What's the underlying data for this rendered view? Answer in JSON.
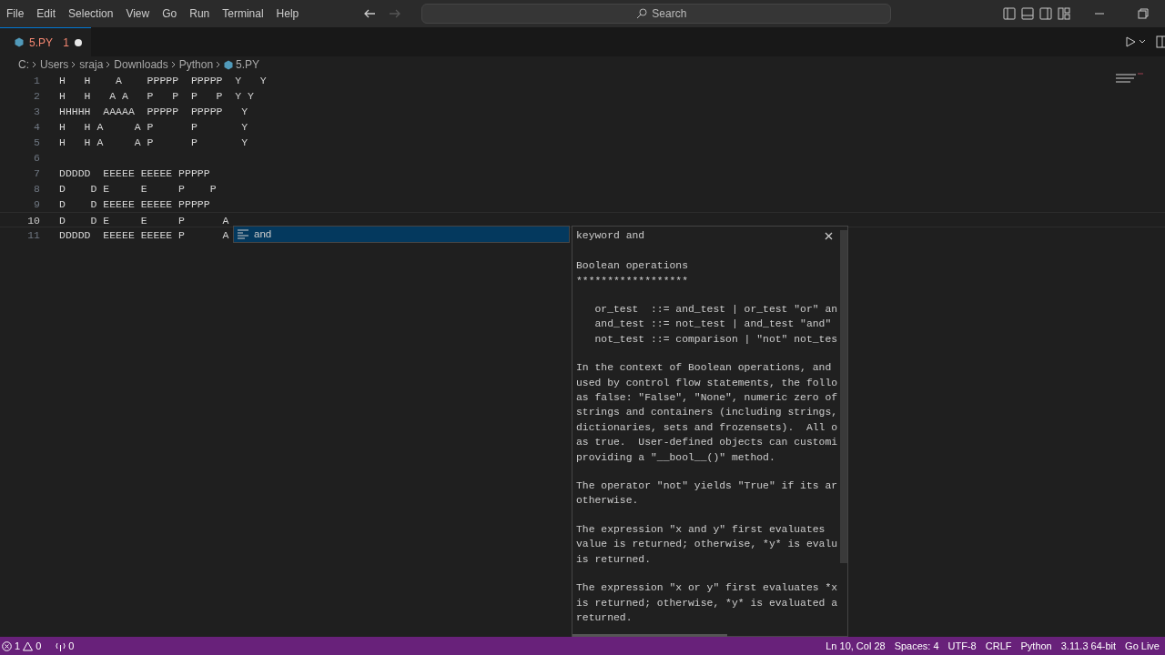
{
  "menu": [
    "File",
    "Edit",
    "Selection",
    "View",
    "Go",
    "Run",
    "Terminal",
    "Help"
  ],
  "command_center": {
    "placeholder": "Search"
  },
  "tabs": [
    {
      "label": "5.PY",
      "problems": "1",
      "modified": true,
      "selected": true
    }
  ],
  "breadcrumbs": [
    "C:",
    "Users",
    "sraja",
    "Downloads",
    "Python",
    "5.PY"
  ],
  "editor": {
    "lines": [
      {
        "number": "1",
        "text": "H   H    A    PPPPP  PPPPP  Y   Y",
        "current": false
      },
      {
        "number": "2",
        "text": "H   H   A A   P   P  P   P  Y Y",
        "current": false
      },
      {
        "number": "3",
        "text": "HHHHH  AAAAA  PPPPP  PPPPP   Y",
        "current": false
      },
      {
        "number": "4",
        "text": "H   H A     A P      P       Y",
        "current": false
      },
      {
        "number": "5",
        "text": "H   H A     A P      P       Y",
        "current": false
      },
      {
        "number": "6",
        "current": false
      },
      {
        "number": "7",
        "text": "DDDDD  EEEEE EEEEE PPPPP",
        "current": false
      },
      {
        "number": "8",
        "text": "D    D E     E     P    P",
        "current": false
      },
      {
        "number": "9",
        "text": "D    D EEEEE EEEEE PPPPP",
        "current": false
      },
      {
        "number": "10",
        "text": "D    D E     E     P      A",
        "current": true
      },
      {
        "number": "11",
        "text": "DDDDD  EEEEE EEEEE P      A",
        "current": false
      }
    ]
  },
  "suggest": {
    "items": [
      {
        "label": "and",
        "selected": true
      }
    ]
  },
  "hover": {
    "title": "keyword and",
    "paragraphs": [
      [
        "Boolean operations",
        "******************"
      ],
      [
        "   or_test  ::= and_test | or_test \"or\" an",
        "   and_test ::= not_test | and_test \"and\"",
        "   not_test ::= comparison | \"not\" not_tes"
      ],
      [
        "In the context of Boolean operations, and",
        "used by control flow statements, the follo",
        "as false: \"False\", \"None\", numeric zero of",
        "strings and containers (including strings,",
        "dictionaries, sets and frozensets).  All o",
        "as true.  User-defined objects can customi",
        "providing a \"__bool__()\" method."
      ],
      [
        "The operator \"not\" yields \"True\" if its ar",
        "otherwise."
      ],
      [
        "The expression \"x and y\" first evaluates",
        "value is returned; otherwise, *y* is evalu",
        "is returned."
      ],
      [
        "The expression \"x or y\" first evaluates *x",
        "is returned; otherwise, *y* is evaluated a",
        "returned."
      ]
    ]
  },
  "status_bar": {
    "errors": "1",
    "warnings": "0",
    "ports": "0",
    "items": [
      "Ln 10, Col 28",
      "Spaces: 4",
      "UTF-8",
      "CRLF",
      "Python",
      "3.11.3 64-bit",
      "Go Live"
    ]
  }
}
